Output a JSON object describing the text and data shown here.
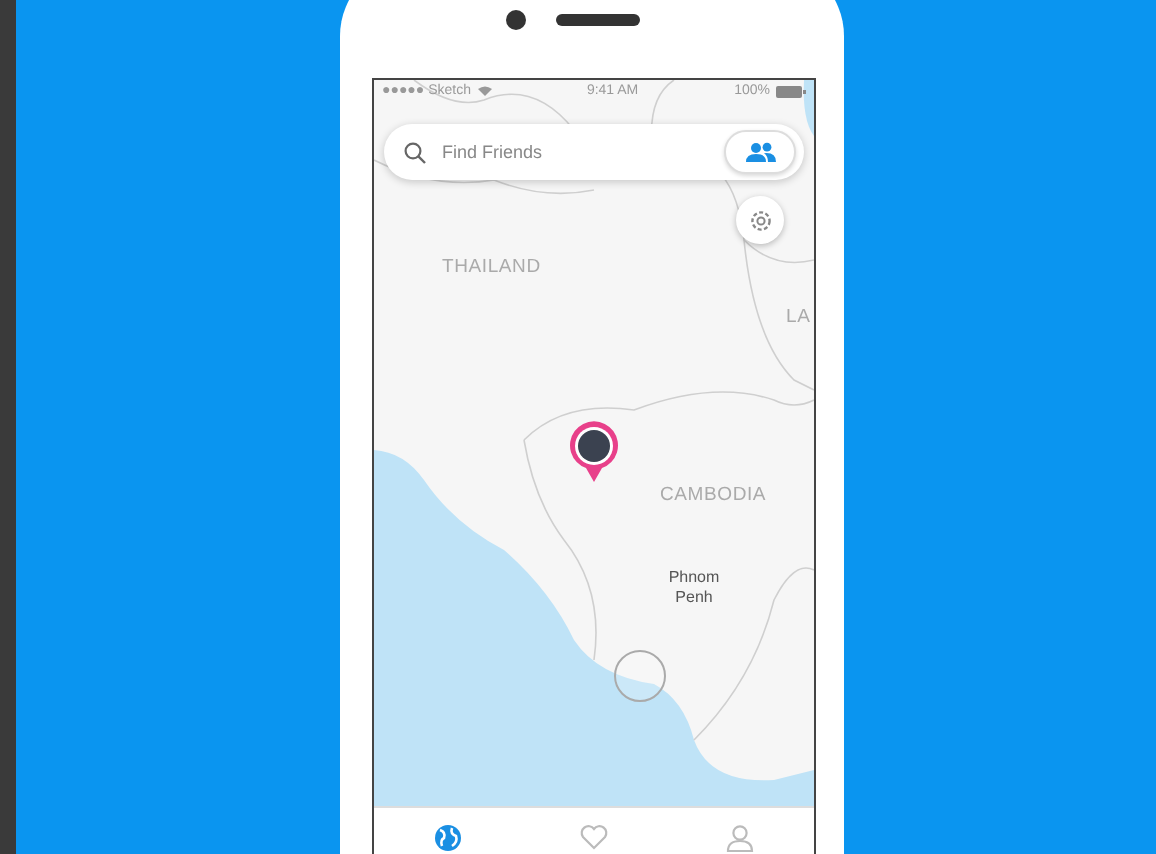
{
  "status_bar": {
    "carrier": "●●●●● Sketch",
    "time": "9:41 AM",
    "battery": "100%"
  },
  "search": {
    "placeholder": "Find Friends"
  },
  "map": {
    "labels": [
      {
        "text": "THAILAND",
        "kind": "country"
      },
      {
        "text": "LA",
        "kind": "country"
      },
      {
        "text": "CAMBODIA",
        "kind": "country"
      },
      {
        "text": "Phnom Penh",
        "kind": "city"
      }
    ]
  },
  "tabs": [
    {
      "kind": "map",
      "selected": true
    },
    {
      "kind": "favorites",
      "selected": false
    },
    {
      "kind": "profile",
      "selected": false
    }
  ]
}
